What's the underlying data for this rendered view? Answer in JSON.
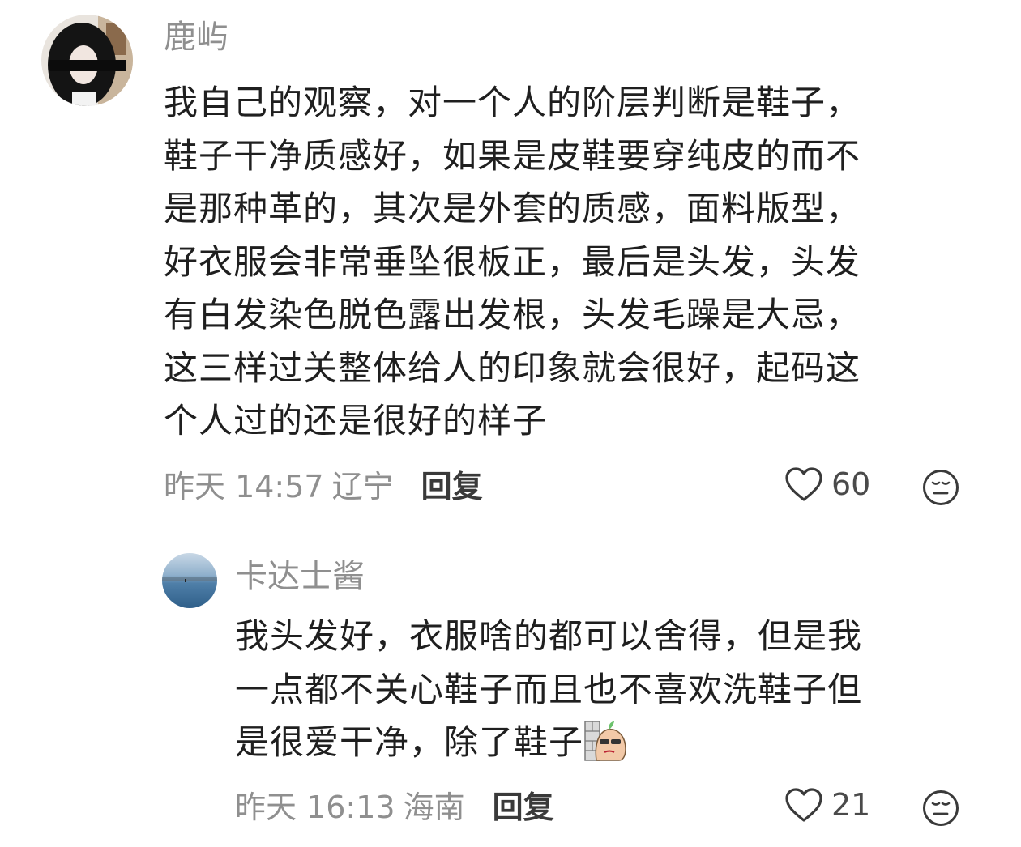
{
  "comments": [
    {
      "username": "鹿屿",
      "lines": [
        "我自己的观察，对一个人的阶层判断是鞋子，",
        "鞋子干净质感好，如果是皮鞋要穿纯皮的而不",
        "是那种革的，其次是外套的质感，面料版型，",
        "好衣服会非常垂坠很板正，最后是头发，头发",
        "有白发染色脱色露出发根，头发毛躁是大忌，",
        "这三样过关整体给人的印象就会很好，起码这",
        "个人过的还是很好的样子"
      ],
      "time": "昨天 14:57",
      "location": "辽宁",
      "reply_label": "回复",
      "likes": "60",
      "like_icon": "heart-outline-icon",
      "react_icon": "emoji-face-icon"
    },
    {
      "username": "卡达士酱",
      "lines": [
        "我头发好，衣服啥的都可以舍得，但是我",
        "一点都不关心鞋子而且也不喜欢洗鞋子但",
        "是很爱干净，除了鞋子"
      ],
      "sticker": "peanut-wall-sticker",
      "time": "昨天 16:13",
      "location": "海南",
      "reply_label": "回复",
      "likes": "21",
      "like_icon": "heart-outline-icon",
      "react_icon": "emoji-face-icon"
    }
  ],
  "colors": {
    "username": "#8f8f8f",
    "text": "#1f1f1f",
    "meta": "#8f8f8f",
    "reply": "#3a3a3a"
  }
}
